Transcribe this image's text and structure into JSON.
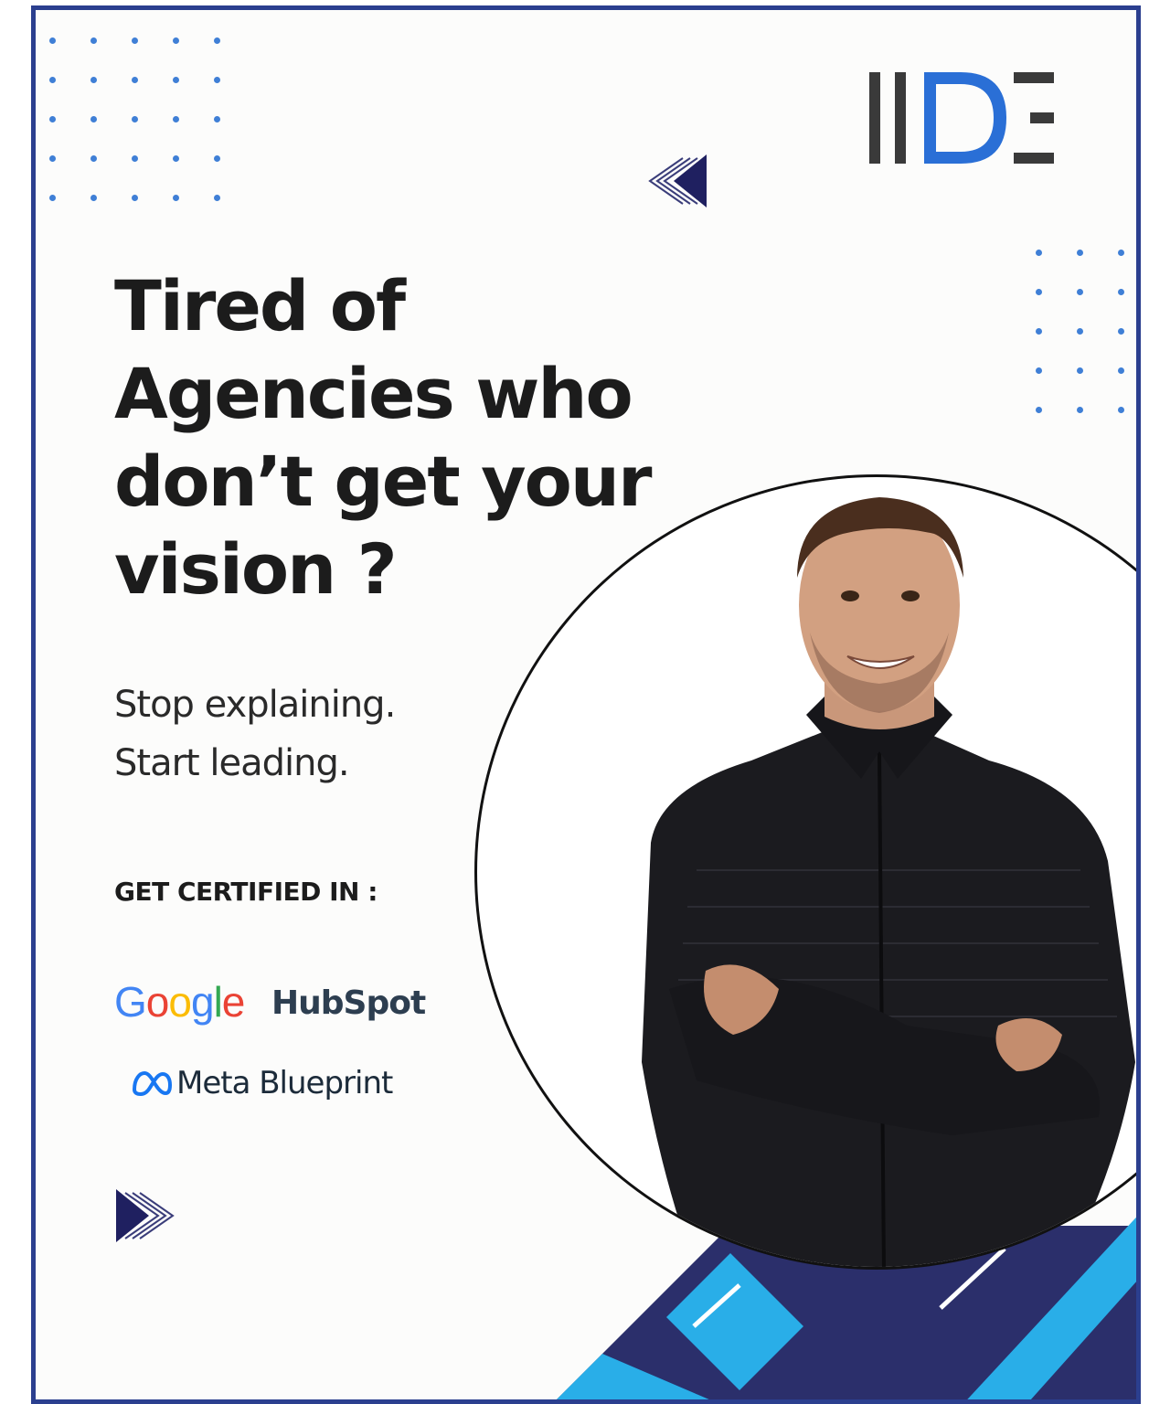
{
  "brand": {
    "logo_text": "IIDE",
    "colors": {
      "navy": "#2b2f6b",
      "blue": "#2a6fd6",
      "sky": "#29aee8",
      "border": "#2b3f8f",
      "dot": "#3f7fd6"
    }
  },
  "headline": {
    "lines": [
      "Tired of",
      "Agencies who",
      "don’t get your",
      "vision ?"
    ]
  },
  "subline": {
    "lines": [
      "Stop explaining.",
      "Start leading."
    ]
  },
  "certified_label": "GET CERTIFIED IN :",
  "partners": {
    "google": [
      "G",
      "o",
      "o",
      "g",
      "l",
      "e"
    ],
    "hubspot": "HubSpot",
    "meta": "Meta Blueprint"
  },
  "icons": {
    "arrow_top": "double-arrow-left-icon",
    "arrow_bottom": "double-arrow-right-icon",
    "meta_logo": "meta-infinity-icon"
  }
}
